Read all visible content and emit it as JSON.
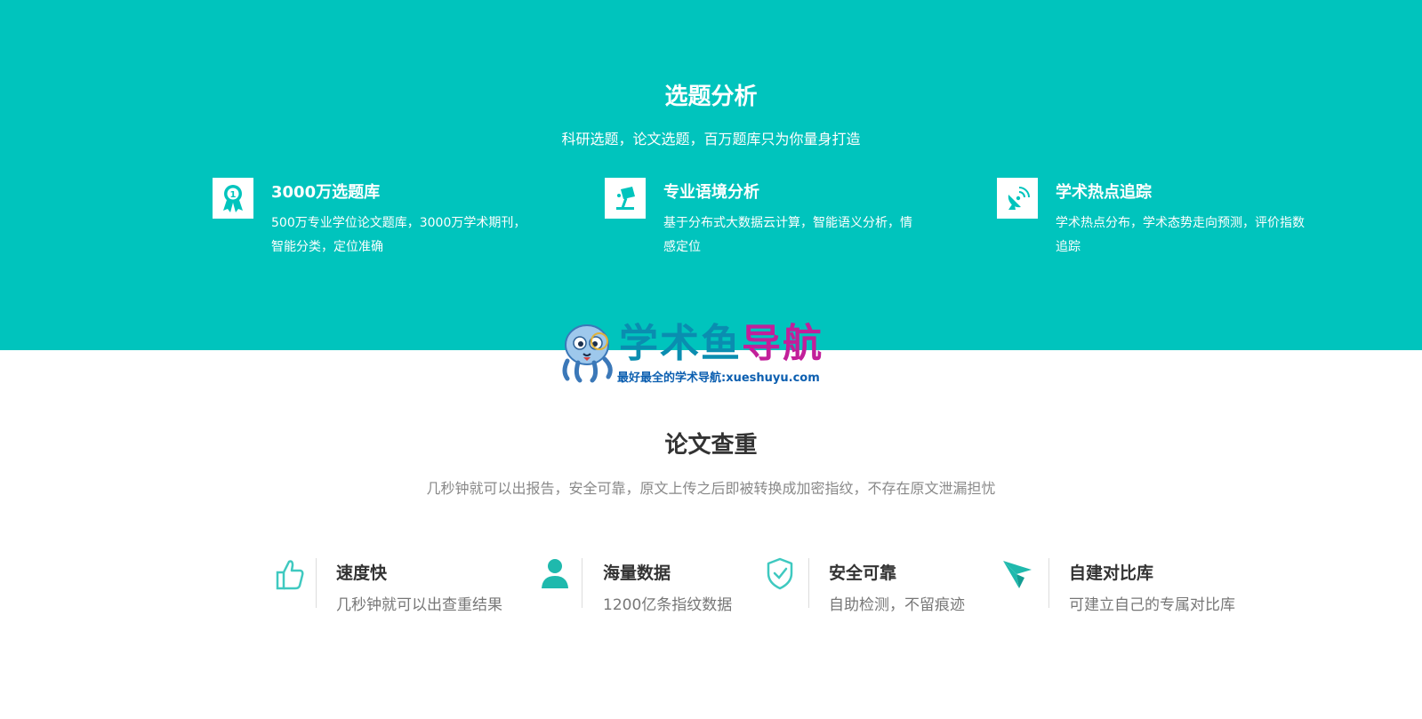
{
  "topic_analysis": {
    "title": "选题分析",
    "subtitle": "科研选题，论文选题，百万题库只为你量身打造",
    "features": [
      {
        "icon": "award-icon",
        "title": "3000万选题库",
        "desc": "500万专业学位论文题库，3000万学术期刊，智能分类，定位准确"
      },
      {
        "icon": "lamp-icon",
        "title": "专业语境分析",
        "desc": "基于分布式大数据云计算，智能语义分析，情感定位"
      },
      {
        "icon": "satellite-icon",
        "title": "学术热点追踪",
        "desc": "学术热点分布，学术态势走向预测，评价指数追踪"
      }
    ]
  },
  "logo": {
    "brand_main": "学术鱼",
    "brand_accent": "导航",
    "tagline": "最好最全的学术导航:xueshuyu.com"
  },
  "plagiarism_check": {
    "title": "论文查重",
    "subtitle": "几秒钟就可以出报告，安全可靠，原文上传之后即被转换成加密指纹，不存在原文泄漏担忧",
    "stats": [
      {
        "icon": "thumbs-up-icon",
        "title": "速度快",
        "desc": "几秒钟就可以出查重结果"
      },
      {
        "icon": "user-icon",
        "title": "海量数据",
        "desc": "1200亿条指纹数据"
      },
      {
        "icon": "shield-check-icon",
        "title": "安全可靠",
        "desc": "自助检测，不留痕迹"
      },
      {
        "icon": "paper-plane-icon",
        "title": "自建对比库",
        "desc": "可建立自己的专属对比库"
      }
    ]
  },
  "colors": {
    "teal": "#00c4bd",
    "brand_blue": "#0a8db0",
    "brand_magenta": "#c21f9a"
  }
}
